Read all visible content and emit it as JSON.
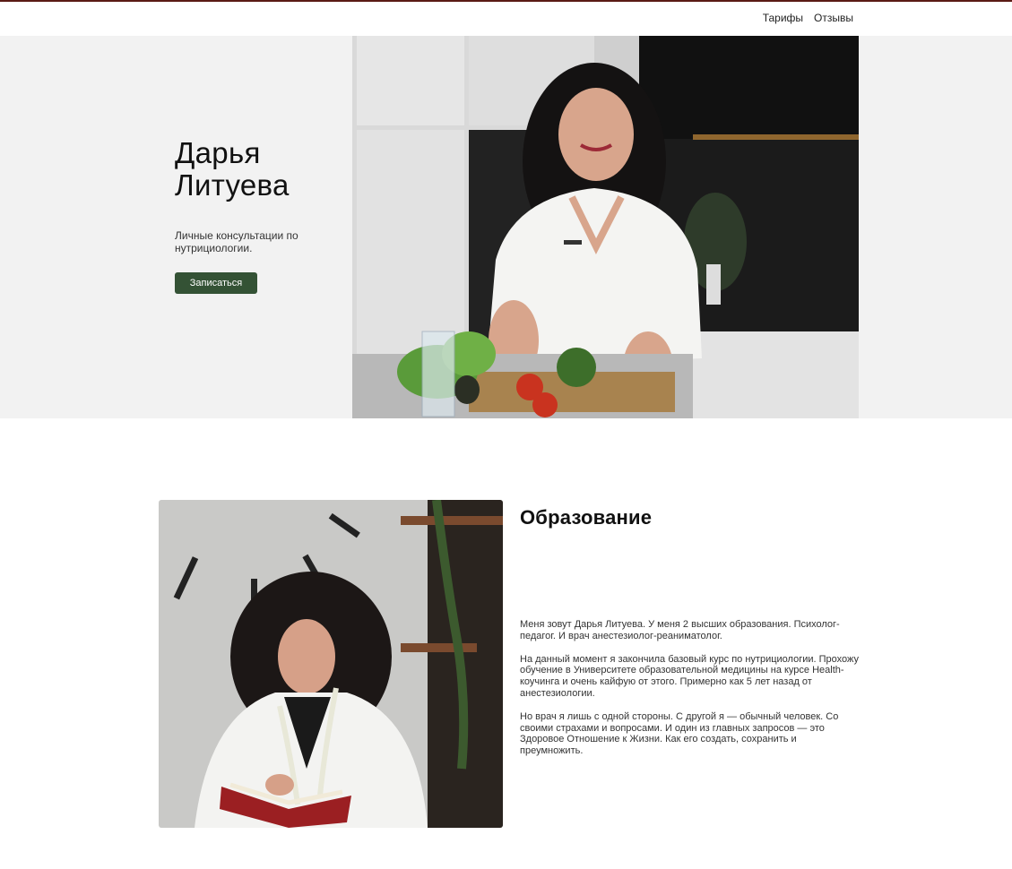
{
  "nav": {
    "links": [
      "Тарифы",
      "Отзывы"
    ]
  },
  "hero": {
    "title": "Дарья Литуева",
    "subtitle": "Личные консультации по нутрициологии.",
    "button_label": "Записаться"
  },
  "education": {
    "title": "Образование",
    "paragraphs": [
      "Меня зовут Дарья Литуева. У меня 2 высших образования. Психолог-педагог. И врач анестезиолог-реаниматолог.",
      "На данный момент я закончила базовый курс по нутрициологии. Прохожу обучение в Университете образовательной медицины на курсе Health-коучинга и очень кайфую от этого. Примерно как 5 лет назад от анестезиологии.",
      "Но врач я лишь с одной стороны. С другой я — обычный человек. Со своими страхами и вопросами. И один из главных запросов — это Здоровое Отношение к Жизни. Как его создать, сохранить и преумножить."
    ]
  },
  "colors": {
    "accent": "#345235",
    "top_border": "#5a1a14",
    "hero_bg": "#f2f2f2"
  }
}
